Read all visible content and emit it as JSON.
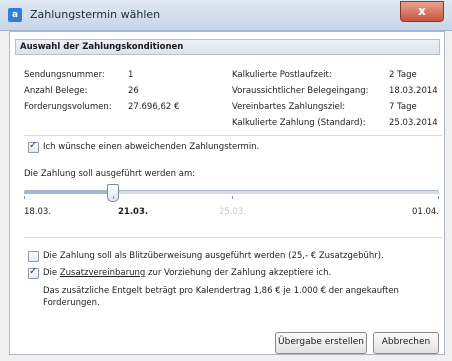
{
  "window": {
    "title": "Zahlungstermin wählen",
    "close_label": "x"
  },
  "section": {
    "title": "Auswahl der Zahlungskonditionen"
  },
  "info_left": [
    {
      "label": "Sendungsnummer:",
      "value": "1"
    },
    {
      "label": "Anzahl Belege:",
      "value": "26"
    },
    {
      "label": "Forderungsvolumen:",
      "value": "27.696,62 €"
    }
  ],
  "info_right": [
    {
      "label": "Kalkulierte Postlaufzeit:",
      "value": "2 Tage"
    },
    {
      "label": "Voraussichtlicher Belegeingang:",
      "value": "18.03.2014"
    },
    {
      "label": "Vereinbartes Zahlungsziel:",
      "value": "7 Tage"
    },
    {
      "label": "Kalkulierte Zahlung (Standard):",
      "value": "25.03.2014"
    }
  ],
  "deviating_date": {
    "checked": true,
    "label": "Ich wünsche einen abweichenden Zahlungstermin."
  },
  "slider": {
    "label": "Die Zahlung soll ausgeführt werden am:",
    "min_label": "18.03.",
    "selected_label": "21.03.",
    "standard_label": "25.03.",
    "max_label": "01.04.",
    "position_fraction": 0.214
  },
  "blitz": {
    "checked": false,
    "label": "Die Zahlung soll als Blitzüberweisung ausgeführt werden (25,- € Zusatzgebühr)."
  },
  "agreement": {
    "checked": true,
    "prefix": "Die",
    "link": "Zusatzvereinbarung",
    "suffix": "zur Vorziehung der Zahlung akzeptiere ich.",
    "note_line1": "Das zusätzliche Entgelt beträgt pro Kalendertrag 1,86 € je 1.000 € der angekauften",
    "note_line2": "Forderungen."
  },
  "buttons": {
    "submit": "Übergabe erstellen",
    "cancel": "Abbrechen"
  }
}
